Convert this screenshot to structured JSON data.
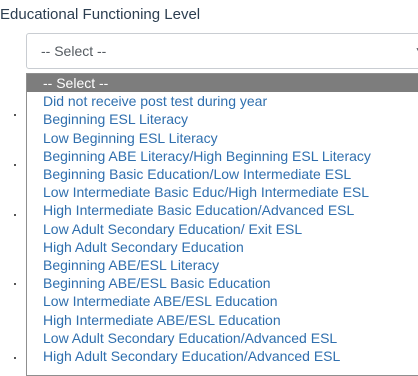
{
  "field": {
    "label": "Educational Functioning Level",
    "selected_value": "-- Select --",
    "chevron_icon": "chevron-down-icon"
  },
  "dropdown": {
    "options": [
      "-- Select --",
      "Did not receive post test during year",
      "Beginning ESL Literacy",
      "Low Beginning ESL Literacy",
      "Beginning ABE Literacy/High Beginning ESL Literacy",
      "Beginning Basic Education/Low Intermediate ESL",
      "Low Intermediate Basic Educ/High Intermediate ESL",
      "High Intermediate Basic Education/Advanced ESL",
      "Low Adult Secondary Education/ Exit ESL",
      "High Adult Secondary Education",
      "Beginning ABE/ESL Literacy",
      "Beginning ABE/ESL Basic Education",
      "Low Intermediate ABE/ESL Education",
      "High Intermediate ABE/ESL Education",
      "Low Adult Secondary Education/Advanced ESL",
      "High Adult Secondary Education/Advanced ESL"
    ],
    "highlighted_index": 0
  },
  "colors": {
    "label_text": "#2c3e50",
    "option_text": "#2f6fae",
    "highlight_background": "#7d7d7d",
    "highlight_text": "#ffffff"
  }
}
